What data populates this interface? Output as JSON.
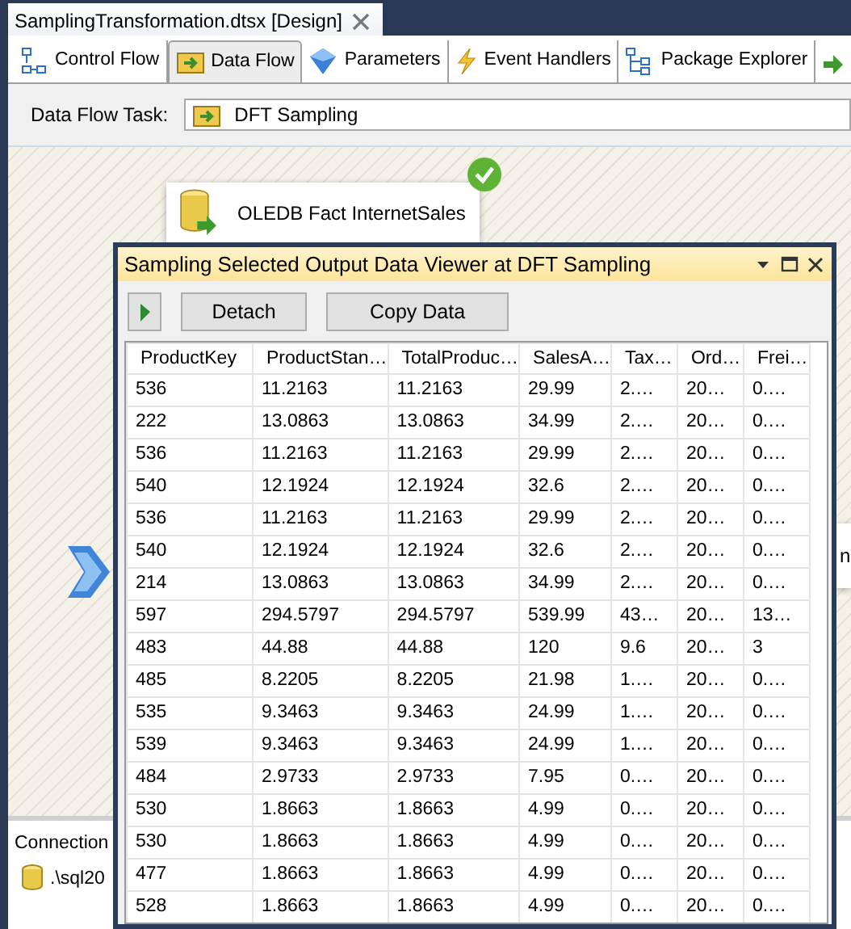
{
  "document_tab": {
    "title": "SamplingTransformation.dtsx [Design]"
  },
  "designer_tabs": [
    {
      "label": "Control Flow",
      "selected": false
    },
    {
      "label": "Data Flow",
      "selected": true
    },
    {
      "label": "Parameters",
      "selected": false
    },
    {
      "label": "Event Handlers",
      "selected": false
    },
    {
      "label": "Package Explorer",
      "selected": false
    }
  ],
  "task_bar": {
    "label": "Data Flow Task:",
    "value": "DFT Sampling"
  },
  "canvas": {
    "components": [
      {
        "kind": "source",
        "label": "OLEDB Fact InternetSales",
        "succeeded": true
      },
      {
        "kind": "transform"
      },
      {
        "kind": "partial",
        "label": "n"
      }
    ]
  },
  "connection_managers": {
    "title": "Connection",
    "items": [
      ".\\sql20"
    ]
  },
  "data_viewer": {
    "title": "Sampling Selected Output Data Viewer at DFT Sampling",
    "buttons": [
      "Detach",
      "Copy Data"
    ],
    "columns": [
      "ProductKey",
      "ProductStan…",
      "TotalProduc…",
      "SalesA…",
      "Tax…",
      "Ord…",
      "Frei…"
    ],
    "rows": [
      [
        "536",
        "11.2163",
        "11.2163",
        "29.99",
        "2.…",
        "20…",
        "0.…"
      ],
      [
        "222",
        "13.0863",
        "13.0863",
        "34.99",
        "2.…",
        "20…",
        "0.…"
      ],
      [
        "536",
        "11.2163",
        "11.2163",
        "29.99",
        "2.…",
        "20…",
        "0.…"
      ],
      [
        "540",
        "12.1924",
        "12.1924",
        "32.6",
        "2.…",
        "20…",
        "0.…"
      ],
      [
        "536",
        "11.2163",
        "11.2163",
        "29.99",
        "2.…",
        "20…",
        "0.…"
      ],
      [
        "540",
        "12.1924",
        "12.1924",
        "32.6",
        "2.…",
        "20…",
        "0.…"
      ],
      [
        "214",
        "13.0863",
        "13.0863",
        "34.99",
        "2.…",
        "20…",
        "0.…"
      ],
      [
        "597",
        "294.5797",
        "294.5797",
        "539.99",
        "43…",
        "20…",
        "13…"
      ],
      [
        "483",
        "44.88",
        "44.88",
        "120",
        "9.6",
        "20…",
        "3"
      ],
      [
        "485",
        "8.2205",
        "8.2205",
        "21.98",
        "1.…",
        "20…",
        "0.…"
      ],
      [
        "535",
        "9.3463",
        "9.3463",
        "24.99",
        "1.…",
        "20…",
        "0.…"
      ],
      [
        "539",
        "9.3463",
        "9.3463",
        "24.99",
        "1.…",
        "20…",
        "0.…"
      ],
      [
        "484",
        "2.9733",
        "2.9733",
        "7.95",
        "0.…",
        "20…",
        "0.…"
      ],
      [
        "530",
        "1.8663",
        "1.8663",
        "4.99",
        "0.…",
        "20…",
        "0.…"
      ],
      [
        "530",
        "1.8663",
        "1.8663",
        "4.99",
        "0.…",
        "20…",
        "0.…"
      ],
      [
        "477",
        "1.8663",
        "1.8663",
        "4.99",
        "0.…",
        "20…",
        "0.…"
      ],
      [
        "528",
        "1.8663",
        "1.8663",
        "4.99",
        "0.…",
        "20…",
        "0.…"
      ]
    ]
  }
}
